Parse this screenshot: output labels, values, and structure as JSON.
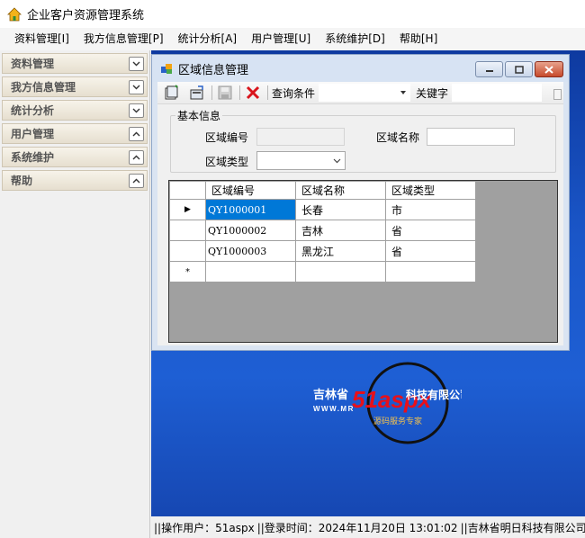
{
  "app": {
    "title": "企业客户资源管理系统"
  },
  "menu": [
    {
      "label": "资料管理[I]"
    },
    {
      "label": "我方信息管理[P]"
    },
    {
      "label": "统计分析[A]"
    },
    {
      "label": "用户管理[U]"
    },
    {
      "label": "系统维护[D]"
    },
    {
      "label": "帮助[H]"
    }
  ],
  "sidebar": {
    "sections": [
      {
        "label": "资料管理",
        "state": "collapsed",
        "icon": "chevron-down-icon"
      },
      {
        "label": "我方信息管理",
        "state": "collapsed",
        "icon": "chevron-down-icon"
      },
      {
        "label": "统计分析",
        "state": "collapsed",
        "icon": "chevron-down-icon"
      },
      {
        "label": "用户管理",
        "state": "expanded",
        "icon": "chevron-up-icon"
      },
      {
        "label": "系统维护",
        "state": "expanded",
        "icon": "chevron-up-icon"
      },
      {
        "label": "帮助",
        "state": "expanded",
        "icon": "chevron-up-icon"
      }
    ]
  },
  "child_window": {
    "title": "区域信息管理",
    "toolbar": {
      "icons": [
        "new-record-icon",
        "edit-record-icon",
        "save-icon",
        "delete-icon"
      ],
      "query_label": "查询条件",
      "query_value": "",
      "keyword_label": "关键字",
      "keyword_value": ""
    },
    "groupbox": {
      "title": "基本信息",
      "region_code_label": "区域编号",
      "region_code_value": "",
      "region_name_label": "区域名称",
      "region_name_value": "",
      "region_type_label": "区域类型",
      "region_type_value": ""
    },
    "grid": {
      "headers": [
        "区域编号",
        "区域名称",
        "区域类型"
      ],
      "rows": [
        [
          "QY1000001",
          "长春",
          "市"
        ],
        [
          "QY1000002",
          "吉林",
          "省"
        ],
        [
          "QY1000003",
          "黑龙江",
          "省"
        ]
      ],
      "current_row_marker": "▶",
      "new_row_marker": "*"
    }
  },
  "logo": {
    "left_text": "吉林省",
    "brand": "51aspx",
    "suffix_text": "科技有限公司",
    "url_text": "WWW.MR",
    "tagline": "源码服务专家"
  },
  "statusbar": {
    "operator": "||操作用户：51aspx",
    "login_time": "||登录时间：2024年11月20日 13:01:02",
    "company": "||吉林省明日科技有限公司制"
  },
  "colors": {
    "desktop_blue": "#1a56c8",
    "selected_cell": "#0078d7",
    "close_button": "#c74a2c"
  }
}
